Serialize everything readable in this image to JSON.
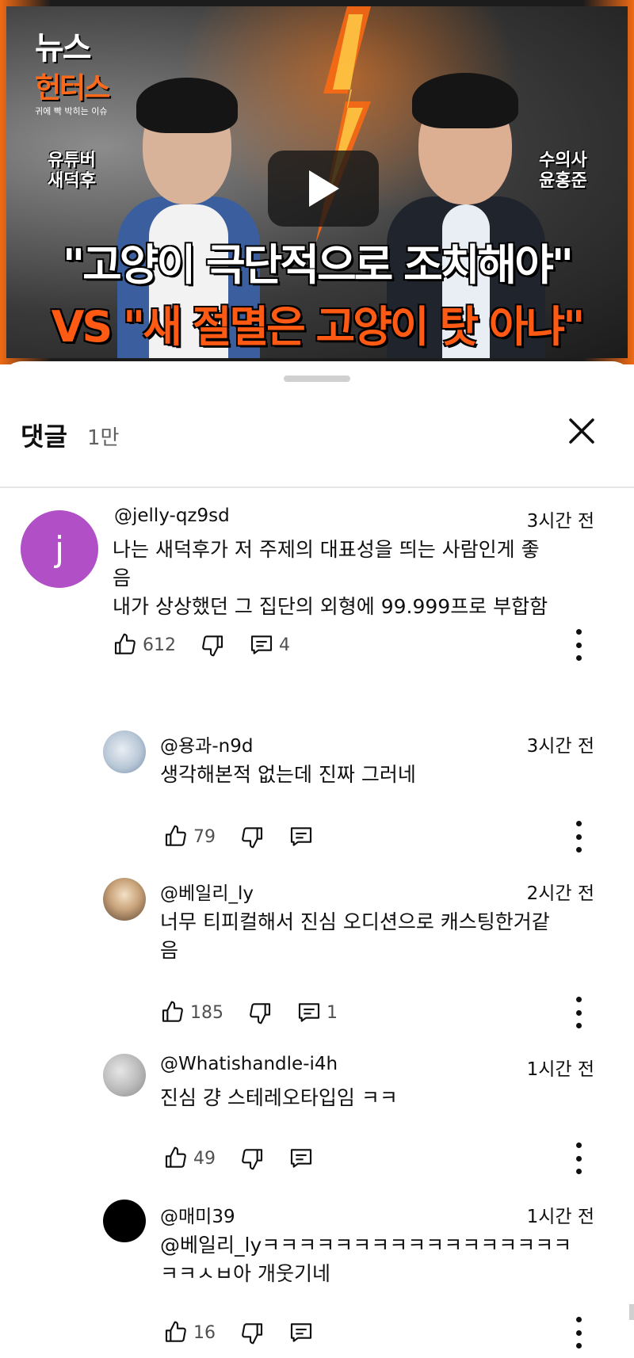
{
  "video": {
    "brand_line1": "뉴스",
    "brand_line2": "헌터스",
    "brand_sub": "귀에 빡 박히는 이슈",
    "left_tag": [
      "유튜버",
      "새덕후"
    ],
    "right_tag": [
      "수의사",
      "윤홍준"
    ],
    "headline1": "\"고양이 극단적으로 조치해야\"",
    "headline2": "VS \"새 절멸은 고양이 탓 아냐\""
  },
  "sheet": {
    "title": "댓글",
    "count": "1만"
  },
  "comments": [
    {
      "author": "@jelly-qz9sd",
      "time": "3시간 전",
      "avatar_letter": "j",
      "avatar_color": "#b04fc6",
      "text_lines": [
        "나는 새덕후가 저 주제의 대표성을 띄는 사람인게 좋",
        "음",
        "내가 상상했던 그 집단의 외형에 99.999프로 부합함"
      ],
      "likes": "612",
      "replies": "4"
    },
    {
      "author": "@용과-n9d",
      "time": "3시간 전",
      "text_lines": [
        "생각해본적 없는데 진짜 그러네"
      ],
      "likes": "79",
      "replies": ""
    },
    {
      "author": "@베일리_ly",
      "time": "2시간 전",
      "text_lines": [
        "너무 티피컬해서 진심 오디션으로 캐스팅한거같",
        "음"
      ],
      "likes": "185",
      "replies": "1"
    },
    {
      "author": "@Whatishandle-i4h",
      "time": "1시간 전",
      "text_lines": [
        "진심 걍 스테레오타입임 ㅋㅋ"
      ],
      "likes": "49",
      "replies": ""
    },
    {
      "author": "@매미39",
      "time": "1시간 전",
      "text_lines": [
        "@베일리_lyㅋㅋㅋㅋㅋㅋㅋㅋㅋㅋㅋㅋㅋㅋㅋㅋㅋ",
        "ㅋㅋㅅㅂ아 개웃기네"
      ],
      "likes": "16",
      "replies": ""
    }
  ],
  "icons": {
    "play": "play-icon",
    "close": "close-icon",
    "like": "thumbs-up-icon",
    "dislike": "thumbs-down-icon",
    "reply": "reply-icon",
    "more": "more-vert-icon"
  }
}
